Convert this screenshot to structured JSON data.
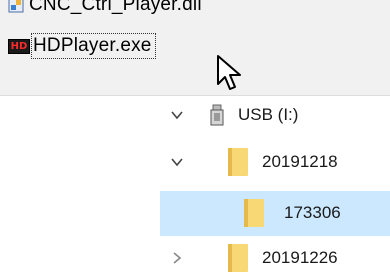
{
  "file_list": {
    "items": [
      {
        "name": "CNC_Ctrl_Player.dll",
        "icon": "dll-file-icon"
      },
      {
        "name": "HDPlayer.exe",
        "icon": "hd-app-icon",
        "icon_text": "HD",
        "focused": true
      }
    ]
  },
  "tree": {
    "drive": {
      "label": "USB (I:)",
      "expanded": true
    },
    "folders": [
      {
        "label": "20191218",
        "expanded": true
      },
      {
        "label": "173306",
        "selected": true
      },
      {
        "label": "20191226",
        "expanded": false
      }
    ]
  },
  "colors": {
    "selection": "#cce8ff",
    "folder": "#f8d775",
    "panel_bg": "#f1f1f1",
    "hd_icon_text": "#ff2a2a"
  }
}
